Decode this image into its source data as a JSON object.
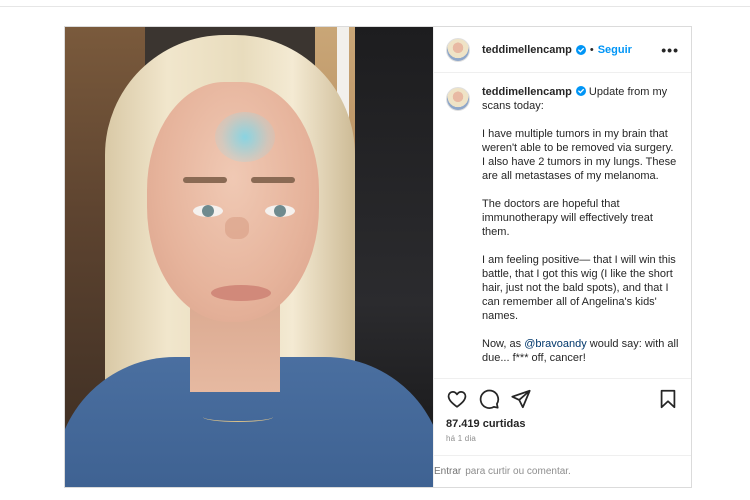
{
  "post": {
    "username": "teddimellencamp",
    "follow_label": "Seguir",
    "separator": "•",
    "more_label": "•••",
    "caption_intro": "Update from my scans today:",
    "caption_paragraphs": [
      "I have multiple tumors in my brain that weren't able to be removed via surgery. I also have 2 tumors in my lungs. These are all metastases of my melanoma.",
      "The doctors are hopeful that immunotherapy will effectively treat them.",
      "I am feeling positive— that I will win this battle, that I got this wig (I like the short hair, just not the bald spots), and that I can remember all of Angelina's kids' names."
    ],
    "final_prefix": "Now, as ",
    "mention": "@bravoandy",
    "final_suffix": " would say: with all due... f*** off, cancer!",
    "likes": "87.419 curtidas",
    "date": "há 1 dia",
    "login_link": "Entrar",
    "login_text": "para curtir ou comentar."
  },
  "icons": {
    "verified": "verified-badge-icon",
    "like": "heart-icon",
    "comment": "comment-icon",
    "share": "share-icon",
    "save": "bookmark-icon"
  },
  "colors": {
    "accent": "#0095f6",
    "verified": "#0095f6",
    "text": "#262626",
    "muted": "#8e8e8e",
    "border": "#dbdbdb"
  }
}
